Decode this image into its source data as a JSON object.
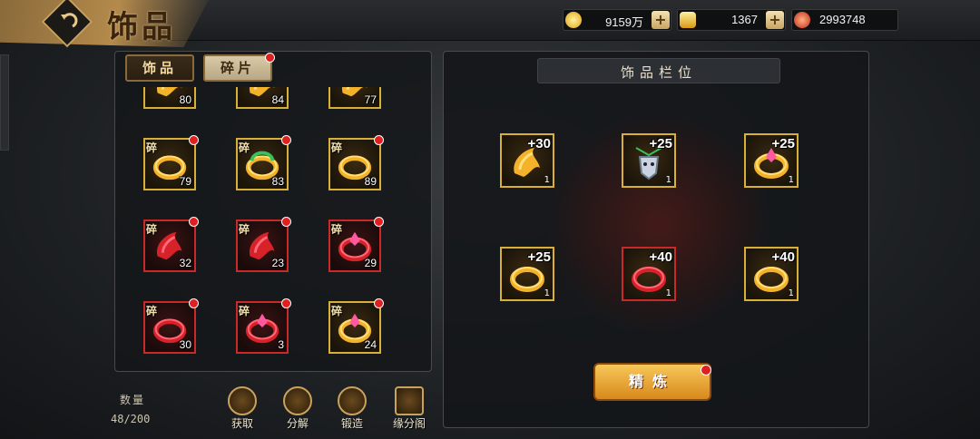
{
  "header": {
    "title": "饰品",
    "resources": [
      {
        "name": "gold",
        "value": "9159万",
        "color": "#f2c12e"
      },
      {
        "name": "ingot",
        "value": "1367",
        "color": "#f0c040"
      },
      {
        "name": "gem",
        "value": "2993748",
        "color": "#d83a2a"
      }
    ]
  },
  "tabs": [
    {
      "label": "饰品",
      "active": true
    },
    {
      "label": "碎片",
      "active": false,
      "badge": true
    }
  ],
  "fragment_label": "碎",
  "inventory": [
    {
      "count": "80",
      "frag": false,
      "dot": false,
      "rarity": "gold",
      "icon": "gold-flame-accessory-icon"
    },
    {
      "count": "84",
      "frag": false,
      "dot": false,
      "rarity": "gold",
      "icon": "gold-crown-accessory-icon"
    },
    {
      "count": "77",
      "frag": false,
      "dot": false,
      "rarity": "gold",
      "icon": "gold-wing-accessory-icon"
    },
    {
      "count": "79",
      "frag": true,
      "dot": true,
      "rarity": "gold",
      "icon": "gold-swirl-ring-icon"
    },
    {
      "count": "83",
      "frag": true,
      "dot": true,
      "rarity": "gold",
      "icon": "jade-ring-icon"
    },
    {
      "count": "89",
      "frag": true,
      "dot": true,
      "rarity": "gold",
      "icon": "gold-band-icon"
    },
    {
      "count": "32",
      "frag": true,
      "dot": true,
      "rarity": "red",
      "icon": "red-ribbon-icon"
    },
    {
      "count": "23",
      "frag": true,
      "dot": true,
      "rarity": "red",
      "icon": "red-jewel-cluster-icon"
    },
    {
      "count": "29",
      "frag": true,
      "dot": true,
      "rarity": "red",
      "icon": "red-crystal-ring-icon"
    },
    {
      "count": "30",
      "frag": true,
      "dot": true,
      "rarity": "red",
      "icon": "red-spiral-ring-icon"
    },
    {
      "count": "3",
      "frag": true,
      "dot": true,
      "rarity": "red",
      "icon": "red-gem-ring-icon"
    },
    {
      "count": "24",
      "frag": true,
      "dot": true,
      "rarity": "gold",
      "icon": "gold-pink-ring-icon"
    }
  ],
  "footer": {
    "count_label": "数量",
    "count_value": "48/200",
    "actions": [
      {
        "label": "获取",
        "icon": "acquire-icon"
      },
      {
        "label": "分解",
        "icon": "decompose-icon"
      },
      {
        "label": "锻造",
        "icon": "forge-hammer-icon"
      },
      {
        "label": "缘分阁",
        "icon": "pavilion-icon"
      }
    ]
  },
  "slots_panel": {
    "title": "饰品栏位",
    "slots": [
      {
        "level": "+30",
        "stars": "1",
        "rarity": "gold",
        "icon": "gold-flame-accessory-icon"
      },
      {
        "level": "+25",
        "stars": "1",
        "rarity": "gold",
        "icon": "silver-mask-pendant-icon"
      },
      {
        "level": "+25",
        "stars": "1",
        "rarity": "gold",
        "icon": "blue-gem-ring-icon"
      },
      {
        "level": "+25",
        "stars": "1",
        "rarity": "gold",
        "icon": "gold-swirl-ring-icon"
      },
      {
        "level": "+40",
        "stars": "1",
        "rarity": "red",
        "icon": "red-ring-icon"
      },
      {
        "level": "+40",
        "stars": "1",
        "rarity": "gold",
        "icon": "gold-band-icon"
      }
    ],
    "refine_label": "精炼"
  }
}
